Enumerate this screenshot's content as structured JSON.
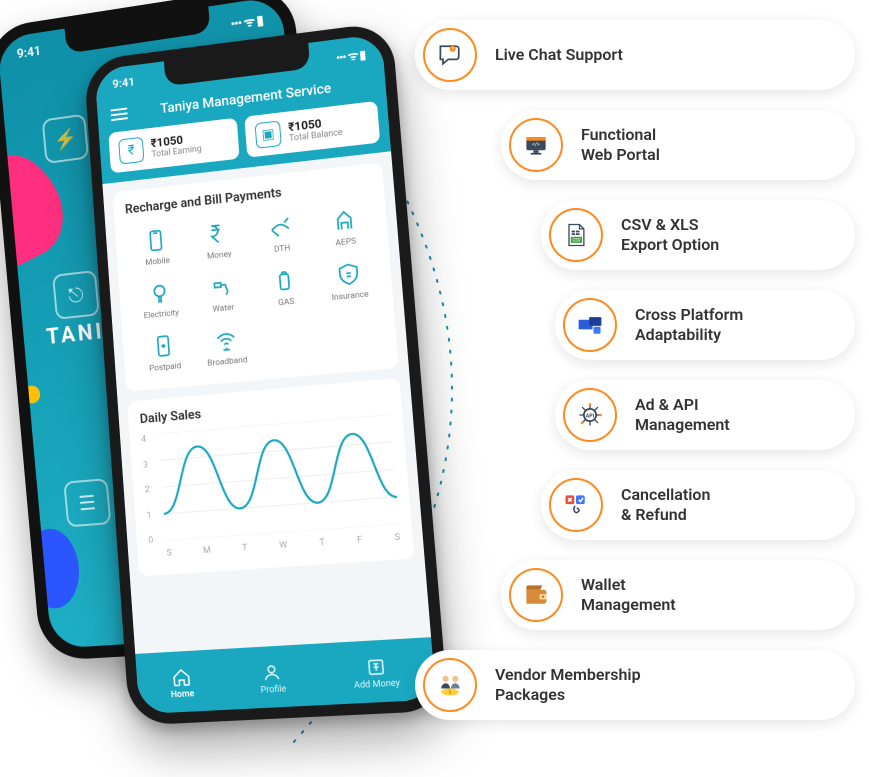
{
  "status_time": "9:41",
  "status_indicators": "••• ᯤ ▮",
  "back_phone": {
    "brand_partial": "TANIYA"
  },
  "app": {
    "title": "Taniya Management Service",
    "earning": {
      "amount": "₹1050",
      "label": "Total Earning"
    },
    "balance": {
      "amount": "₹1050",
      "label": "Total Balance"
    }
  },
  "recharge": {
    "heading": "Recharge and Bill Payments",
    "services": [
      {
        "name": "Mobile"
      },
      {
        "name": "Money"
      },
      {
        "name": "DTH"
      },
      {
        "name": "AEPS"
      },
      {
        "name": "Electricity"
      },
      {
        "name": "Water"
      },
      {
        "name": "GAS"
      },
      {
        "name": "Insurance"
      },
      {
        "name": "Postpaid"
      },
      {
        "name": "Broadband"
      }
    ]
  },
  "sales": {
    "heading": "Daily Sales"
  },
  "chart_data": {
    "type": "line",
    "title": "Daily Sales",
    "xlabel": "",
    "ylabel": "",
    "ylim": [
      0,
      4
    ],
    "categories": [
      "S",
      "M",
      "T",
      "W",
      "T",
      "F",
      "S"
    ],
    "values": [
      1.0,
      3.4,
      1.0,
      3.4,
      1.0,
      3.4,
      1.0
    ]
  },
  "nav": {
    "items": [
      {
        "label": "Home",
        "active": true
      },
      {
        "label": "Profile",
        "active": false
      },
      {
        "label": "Add Money",
        "active": false
      }
    ]
  },
  "features": [
    {
      "label": "Live Chat Support"
    },
    {
      "label": "Functional\nWeb Portal"
    },
    {
      "label": "CSV & XLS\nExport Option"
    },
    {
      "label": "Cross Platform\nAdaptability"
    },
    {
      "label": "Ad & API\nManagement"
    },
    {
      "label": "Cancellation\n& Refund"
    },
    {
      "label": "Wallet\nManagement"
    },
    {
      "label": "Vendor Membership\nPackages"
    }
  ]
}
